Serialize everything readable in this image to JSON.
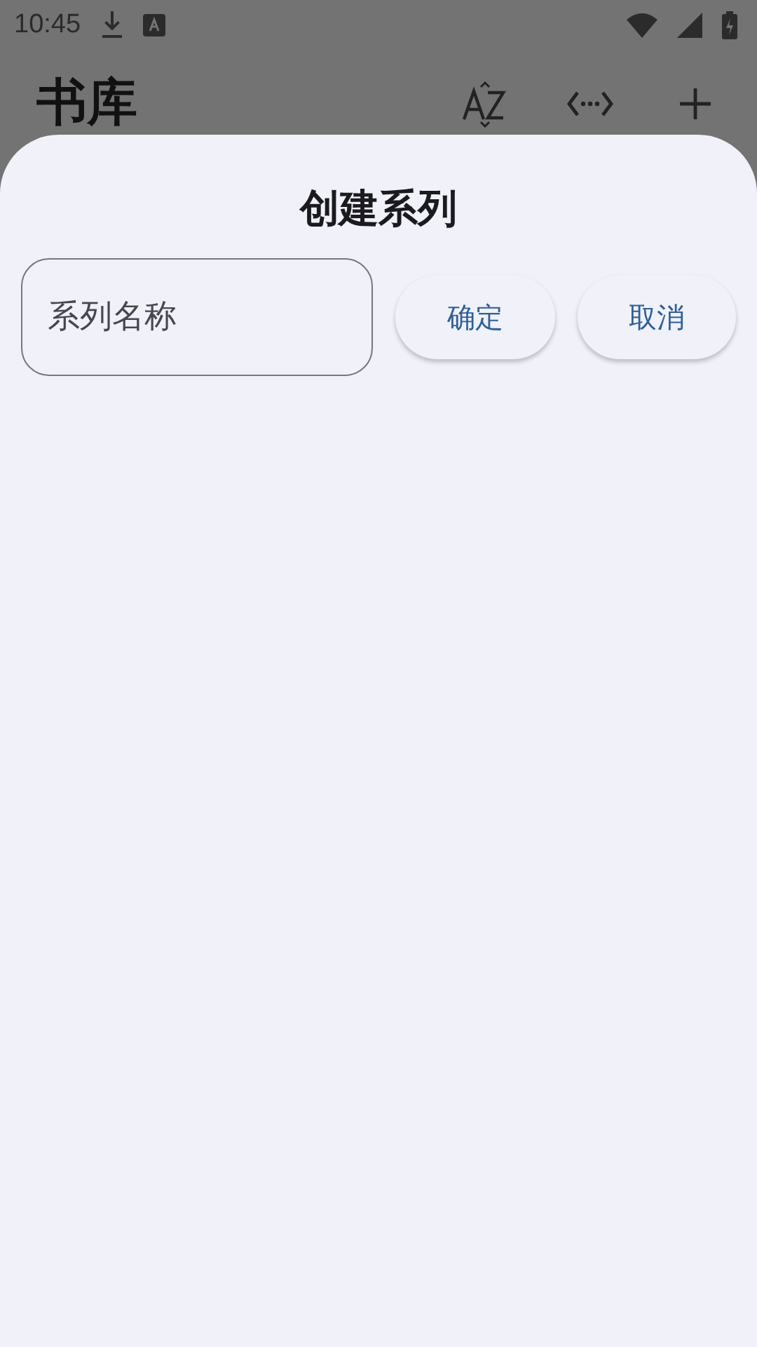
{
  "status_bar": {
    "time": "10:45"
  },
  "app_bar": {
    "title": "书库"
  },
  "sheet": {
    "title": "创建系列",
    "name_field": {
      "placeholder": "系列名称"
    },
    "buttons": [
      "确定",
      "取消"
    ]
  }
}
